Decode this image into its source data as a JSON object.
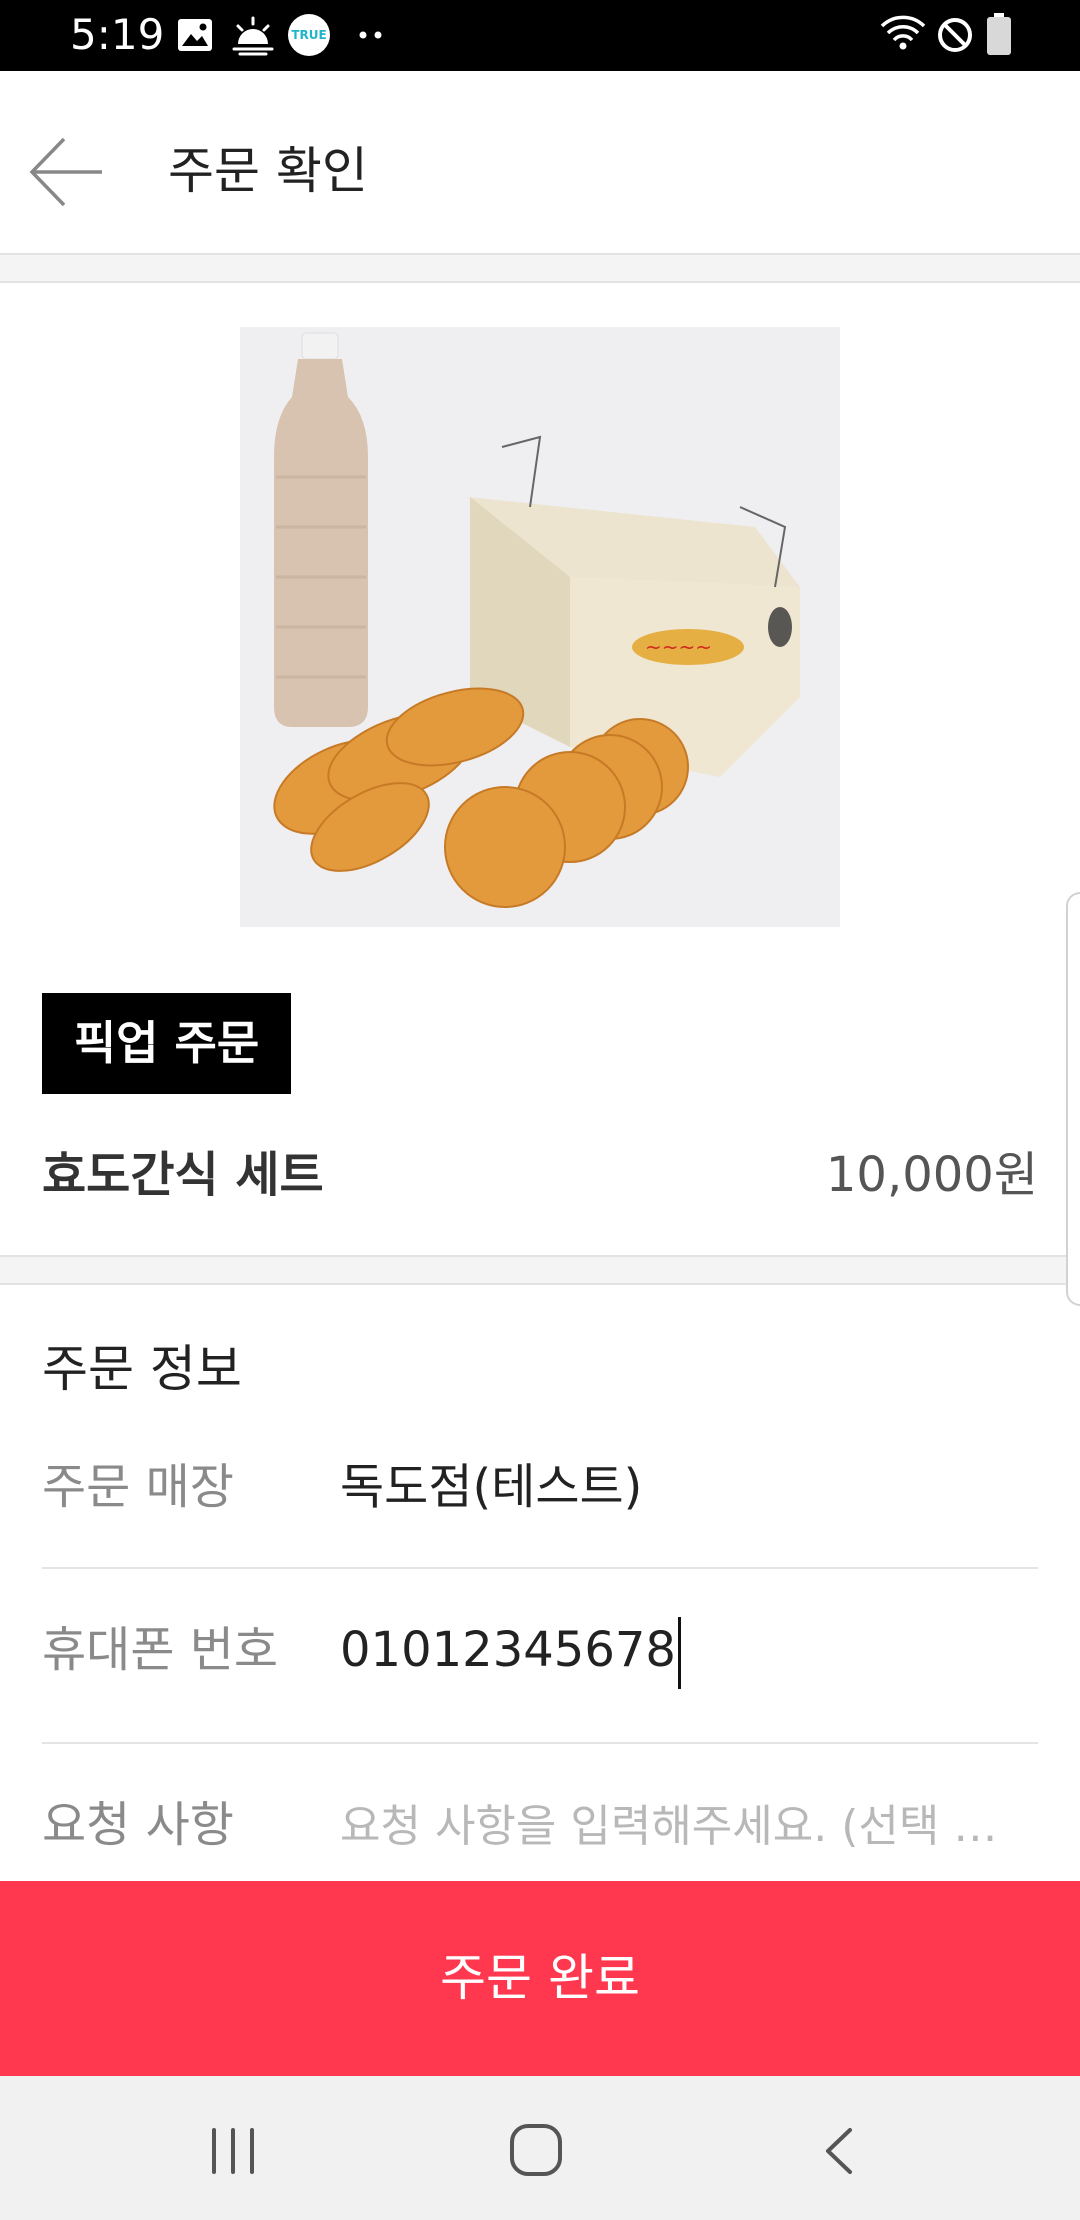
{
  "status_bar": {
    "time": "5:19",
    "left_icons": [
      "gallery-icon",
      "weather-icon",
      "true-app-icon",
      "more-dots-icon"
    ],
    "true_app_text": "TRUE",
    "right_icons": [
      "wifi-icon",
      "do-not-disturb-icon",
      "battery-icon"
    ]
  },
  "header": {
    "back_icon": "arrow-left-icon",
    "title": "주문 확인"
  },
  "product": {
    "badge": "픽업 주문",
    "name": "효도간식 세트",
    "price": "10,000원"
  },
  "order_info": {
    "section_title": "주문 정보",
    "rows": [
      {
        "label": "주문 매장",
        "value": "독도점(테스트)"
      },
      {
        "label": "휴대폰 번호",
        "value": "01012345678"
      },
      {
        "label": "요청 사항",
        "placeholder": "요청 사항을 입력해주세요. (선택 사항)"
      }
    ]
  },
  "footer": {
    "submit_label": "주문 완료"
  },
  "nav_bar": {
    "icons": [
      "recent-apps-icon",
      "home-icon",
      "back-icon"
    ]
  },
  "colors": {
    "accent": "#ff374f",
    "status_bar": "#000000",
    "badge_bg": "#000000",
    "nav_bar": "#f1f1f1"
  }
}
